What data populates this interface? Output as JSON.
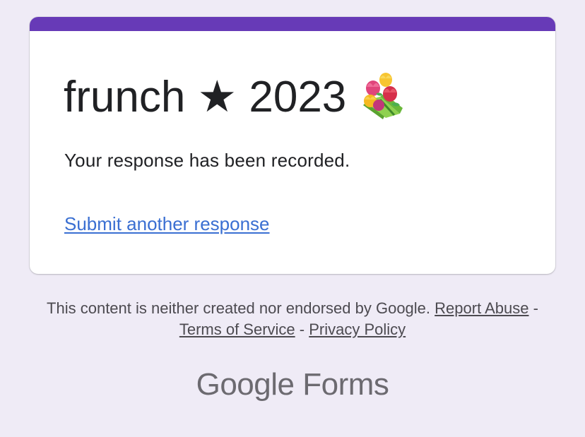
{
  "form": {
    "title": "frunch ★ 2023",
    "title_icon": "bouquet-icon",
    "confirmation_message": "Your response has been recorded.",
    "submit_another_label": "Submit another response"
  },
  "footer": {
    "disclaimer_text": "This content is neither created nor endorsed by Google.",
    "report_abuse_label": "Report Abuse",
    "separator": "-",
    "terms_label": "Terms of Service",
    "privacy_label": "Privacy Policy",
    "logo_brand": "Google",
    "logo_product": "Forms"
  },
  "colors": {
    "background": "#efebf6",
    "accent": "#673ab7",
    "link": "#3a6fd2"
  }
}
